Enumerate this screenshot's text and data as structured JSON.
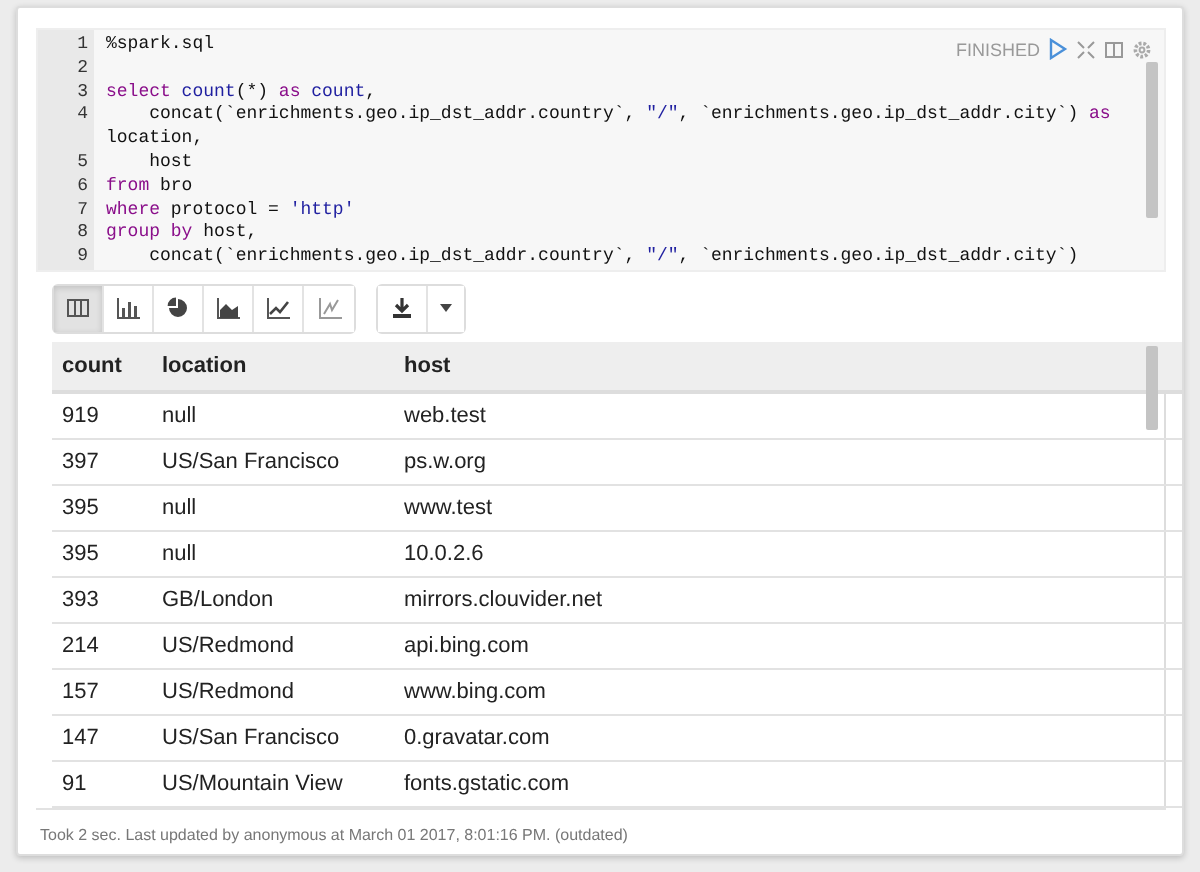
{
  "paragraph": {
    "status": "FINISHED",
    "code_lines": [
      {
        "number": "1",
        "tokens": [
          {
            "kind": "plain",
            "text": "%spark.sql"
          }
        ]
      },
      {
        "number": "2"
      },
      {
        "number": "3",
        "tokens": [
          {
            "kind": "keyword",
            "text": "select"
          },
          {
            "kind": "function",
            "text": " count"
          },
          {
            "kind": "plain",
            "text": "(*) "
          },
          {
            "kind": "keyword",
            "text": "as"
          },
          {
            "kind": "function",
            "text": " count"
          },
          {
            "kind": "plain",
            "text": ","
          }
        ]
      },
      {
        "number": "4",
        "tokens": [
          {
            "kind": "plain",
            "text": "    concat(`enrichments.geo.ip_dst_addr.country`, "
          },
          {
            "kind": "string",
            "text": "\"/\""
          },
          {
            "kind": "plain",
            "text": ", `enrichments.geo.ip_dst_addr.city`) "
          },
          {
            "kind": "keyword",
            "text": "as"
          },
          {
            "kind": "plain",
            "text": " location,"
          }
        ]
      },
      {
        "number": "5",
        "tokens": [
          {
            "kind": "plain",
            "text": "    host"
          }
        ]
      },
      {
        "number": "6",
        "tokens": [
          {
            "kind": "keyword",
            "text": "from"
          },
          {
            "kind": "plain",
            "text": " bro"
          }
        ]
      },
      {
        "number": "7",
        "tokens": [
          {
            "kind": "keyword",
            "text": "where"
          },
          {
            "kind": "plain",
            "text": " protocol = "
          },
          {
            "kind": "string",
            "text": "'http'"
          }
        ]
      },
      {
        "number": "8",
        "tokens": [
          {
            "kind": "keyword",
            "text": "group by"
          },
          {
            "kind": "plain",
            "text": " host,"
          }
        ]
      },
      {
        "number": "9",
        "tokens": [
          {
            "kind": "plain",
            "text": "    concat(`enrichments.geo.ip_dst_addr.country`, "
          },
          {
            "kind": "string",
            "text": "\"/\""
          },
          {
            "kind": "plain",
            "text": ", `enrichments.geo.ip_dst_addr.city`)"
          }
        ]
      }
    ],
    "view_buttons": [
      {
        "kind": "table",
        "selected": true
      },
      {
        "kind": "bar",
        "selected": false
      },
      {
        "kind": "pie",
        "selected": false
      },
      {
        "kind": "area",
        "selected": false
      },
      {
        "kind": "line",
        "selected": false
      },
      {
        "kind": "scatter",
        "selected": false
      }
    ],
    "table": {
      "columns": [
        "count",
        "location",
        "host"
      ],
      "rows": [
        [
          "919",
          "null",
          "web.test"
        ],
        [
          "397",
          "US/San Francisco",
          "ps.w.org"
        ],
        [
          "395",
          "null",
          "www.test"
        ],
        [
          "395",
          "null",
          "10.0.2.6"
        ],
        [
          "393",
          "GB/London",
          "mirrors.clouvider.net"
        ],
        [
          "214",
          "US/Redmond",
          "api.bing.com"
        ],
        [
          "157",
          "US/Redmond",
          "www.bing.com"
        ],
        [
          "147",
          "US/San Francisco",
          "0.gravatar.com"
        ],
        [
          "91",
          "US/Mountain View",
          "fonts.gstatic.com"
        ]
      ]
    },
    "footer": "Took 2 sec. Last updated by anonymous at March 01 2017, 8:01:16 PM. (outdated)"
  }
}
